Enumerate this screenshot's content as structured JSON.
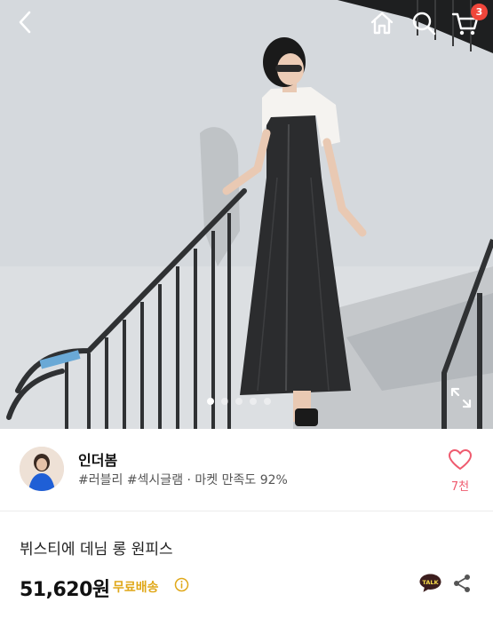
{
  "header": {
    "back_icon": "chevron-left-icon",
    "home_icon": "home-icon",
    "search_icon": "search-icon",
    "cart_icon": "cart-icon",
    "cart_count": "3"
  },
  "gallery": {
    "image_count": 5,
    "active_index": 0,
    "expand_icon": "expand-icon"
  },
  "shop": {
    "name": "인더봄",
    "tags": "#러블리 #섹시글램 · 마켓 만족도 92%",
    "like_icon": "heart-icon",
    "like_count": "7천"
  },
  "product": {
    "title": "뷔스티에 데님 롱 원피스",
    "price": "51,620원",
    "shipping": "무료배송",
    "talk_label": "TALK",
    "share_icon": "share-icon"
  },
  "colors": {
    "badge": "#f0463b",
    "like": "#ef5a6e",
    "shipping": "#e0a81a",
    "talk_bubble": "#3c1e1e"
  }
}
